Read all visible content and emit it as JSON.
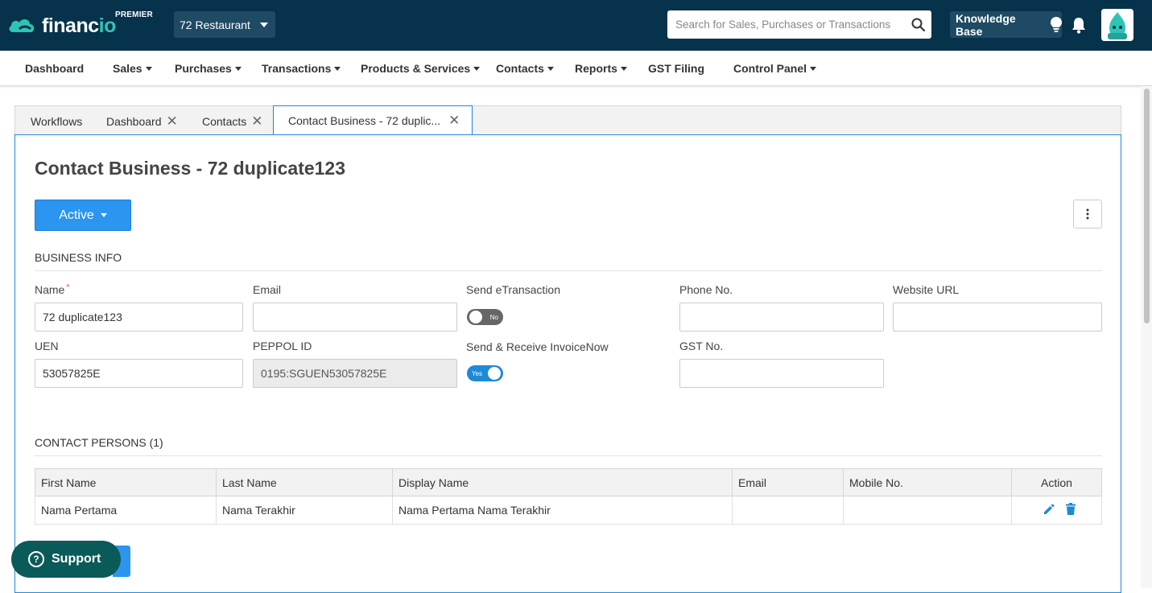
{
  "header": {
    "logo_text_main": "financ",
    "logo_text_accent": "io",
    "tier": "PREMIER",
    "company": "72 Restaurant",
    "search_placeholder": "Search for Sales, Purchases or Transactions",
    "knowledge_base": "Knowledge Base"
  },
  "nav": [
    {
      "label": "Dashboard",
      "dropdown": false
    },
    {
      "label": "Sales",
      "dropdown": true
    },
    {
      "label": "Purchases",
      "dropdown": true
    },
    {
      "label": "Transactions",
      "dropdown": true
    },
    {
      "label": "Products & Services",
      "dropdown": true
    },
    {
      "label": "Contacts",
      "dropdown": true
    },
    {
      "label": "Reports",
      "dropdown": true
    },
    {
      "label": "GST Filing",
      "dropdown": false
    },
    {
      "label": "Control Panel",
      "dropdown": true
    }
  ],
  "tabs": [
    {
      "label": "Workflows"
    },
    {
      "label": "Dashboard"
    },
    {
      "label": "Contacts"
    },
    {
      "label": "Contact Business - 72 duplic..."
    }
  ],
  "page": {
    "title": "Contact Business - 72 duplicate123",
    "status": "Active"
  },
  "business_info": {
    "title": "BUSINESS INFO",
    "name_label": "Name",
    "name_required": "*",
    "name_value": "72 duplicate123",
    "email_label": "Email",
    "email_value": "",
    "send_etx_label": "Send eTransaction",
    "send_etx_state": "No",
    "phone_label": "Phone No.",
    "phone_value": "",
    "website_label": "Website URL",
    "website_value": "",
    "uen_label": "UEN",
    "uen_value": "53057825E",
    "peppol_label": "PEPPOL ID",
    "peppol_value": "0195:SGUEN53057825E",
    "invoicenow_label": "Send & Receive InvoiceNow",
    "invoicenow_state": "Yes",
    "gst_label": "GST No.",
    "gst_value": ""
  },
  "contact_persons": {
    "title": "CONTACT PERSONS (1)",
    "columns": [
      "First Name",
      "Last Name",
      "Display Name",
      "Email",
      "Mobile No.",
      "Action"
    ],
    "rows": [
      {
        "first": "Nama Pertama",
        "last": "Nama Terakhir",
        "display": "Nama Pertama Nama Terakhir",
        "email": "",
        "mobile": ""
      }
    ]
  },
  "support": {
    "label": "Support"
  },
  "colors": {
    "header_bg": "#06324b",
    "primary": "#2b95f0",
    "accent": "#2ec4b6",
    "support_bg": "#0b5a5a"
  }
}
